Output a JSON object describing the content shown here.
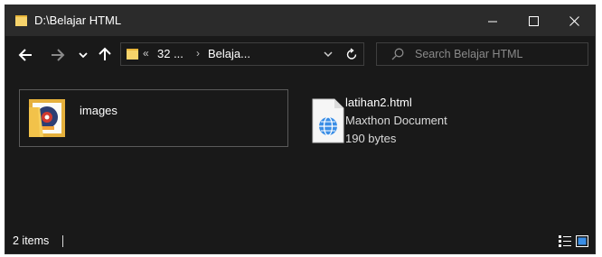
{
  "window": {
    "title": "D:\\Belajar HTML"
  },
  "nav": {
    "overflow_chevron": "«",
    "breadcrumb_seg1": "32 ...",
    "breadcrumb_sep": "›",
    "breadcrumb_seg2": "Belaja...",
    "search_placeholder": "Search Belajar HTML"
  },
  "items": [
    {
      "name": "images",
      "type": "folder",
      "icon": "folder-with-image-icon"
    },
    {
      "name": "latihan2.html",
      "type_label": "Maxthon Document",
      "size": "190 bytes",
      "icon": "html-document-icon"
    }
  ],
  "status": {
    "count": "2 items"
  },
  "colors": {
    "bg": "#191919",
    "titlebar": "#2b2b2b",
    "folder_yellow": "#f0c44d",
    "doc_blue": "#3a8ee6"
  }
}
